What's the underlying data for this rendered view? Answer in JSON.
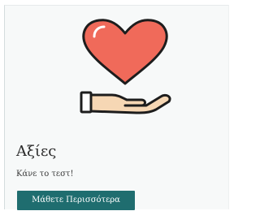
{
  "card": {
    "title": "Αξίες",
    "subtitle": "Κάνε το τεστ!",
    "button_label": "Μάθετε Περισσότερα",
    "illustration_icon": "heart-in-hand-icon"
  },
  "colors": {
    "heart": "#f06a5a",
    "outline": "#1d1d1d",
    "hand": "#f6d7b4",
    "sleeve": "#ffffff",
    "button": "#1f6d6f",
    "background": "#f7f9f9"
  }
}
